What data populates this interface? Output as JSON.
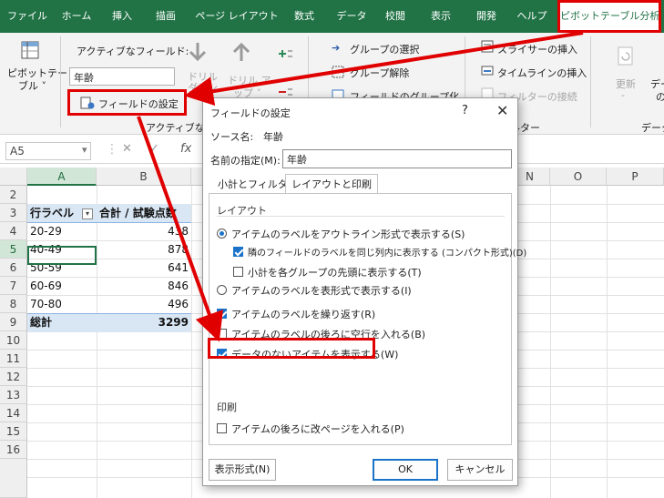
{
  "ribbon": {
    "tabs": [
      "ファイル",
      "ホーム",
      "挿入",
      "描画",
      "ページ レイアウト",
      "数式",
      "データ",
      "校閲",
      "表示",
      "開発",
      "ヘルプ",
      "ピボットテーブル分析"
    ],
    "selected_tab": "ピボットテーブル分析",
    "pivot_table_label_line1": "ピボットテー",
    "pivot_table_label_line2": "ブル ˅",
    "active_field_label": "アクティブなフィールド:",
    "active_field_value": "年齢",
    "drill_down_line1": "ドリル",
    "drill_down_line2": "ダウン",
    "drill_up_line1": "ドリル ア",
    "drill_up_line2": "ップ ˅",
    "field_settings_label": "フィールドの設定",
    "group_active_field": "アクティブなフィ",
    "group_selection": "グループの選択",
    "group_ungroup": "グループ解除",
    "group_field": "フィールドのグループ化",
    "insert_slicer": "スライサーの挿入",
    "insert_timeline": "タイムラインの挿入",
    "filter_connections": "フィルターの接続",
    "filter_group_fragment": "ルター",
    "refresh_label": "更新",
    "data_source_fragment": "デー",
    "data_source_fragment2": "の",
    "data_group_fragment": "データ",
    "dash_label": "-"
  },
  "formula_bar": {
    "name_box": "A5",
    "fx": "fx"
  },
  "sheet": {
    "columns": [
      "A",
      "B",
      "N",
      "O",
      "P"
    ],
    "rows": [
      "2",
      "3",
      "4",
      "5",
      "6",
      "7",
      "8",
      "9",
      "10",
      "11",
      "12",
      "13",
      "14",
      "15",
      "16"
    ],
    "top_row_partial": "",
    "header_row_label": "行ラベル",
    "header_row_value": "合計 / 試験点数",
    "data": [
      {
        "label": "20-29",
        "value": "438"
      },
      {
        "label": "40-49",
        "value": "878"
      },
      {
        "label": "50-59",
        "value": "641"
      },
      {
        "label": "60-69",
        "value": "846"
      },
      {
        "label": "70-80",
        "value": "496"
      }
    ],
    "total_label": "総計",
    "total_value": "3299"
  },
  "dialog": {
    "title": "フィールドの設定",
    "help": "?",
    "close": "✕",
    "source_label": "ソース名:",
    "source_value": "年齢",
    "custom_name_label": "名前の指定(M):",
    "custom_name_value": "年齢",
    "tab_subtotals": "小計とフィルター",
    "tab_layout": "レイアウトと印刷",
    "section_layout": "レイアウト",
    "opt_outline": "アイテムのラベルをアウトライン形式で表示する(S)",
    "opt_compact": "隣のフィールドのラベルを同じ列内に表示する (コンパクト形式)(D)",
    "opt_subtotals_top": "小計を各グループの先頭に表示する(T)",
    "opt_tabular": "アイテムのラベルを表形式で表示する(I)",
    "opt_repeat": "アイテムのラベルを繰り返す(R)",
    "opt_blank_line": "アイテムのラベルの後ろに空行を入れる(B)",
    "opt_show_no_data": "データのないアイテムを表示する(W)",
    "section_print": "印刷",
    "opt_page_break": "アイテムの後ろに改ページを入れる(P)",
    "btn_number_format": "表示形式(N)",
    "btn_ok": "OK",
    "btn_cancel": "キャンセル"
  },
  "colors": {
    "excel_green": "#217346",
    "highlight_red": "#e00000",
    "checkbox_blue": "#1a73c8"
  }
}
